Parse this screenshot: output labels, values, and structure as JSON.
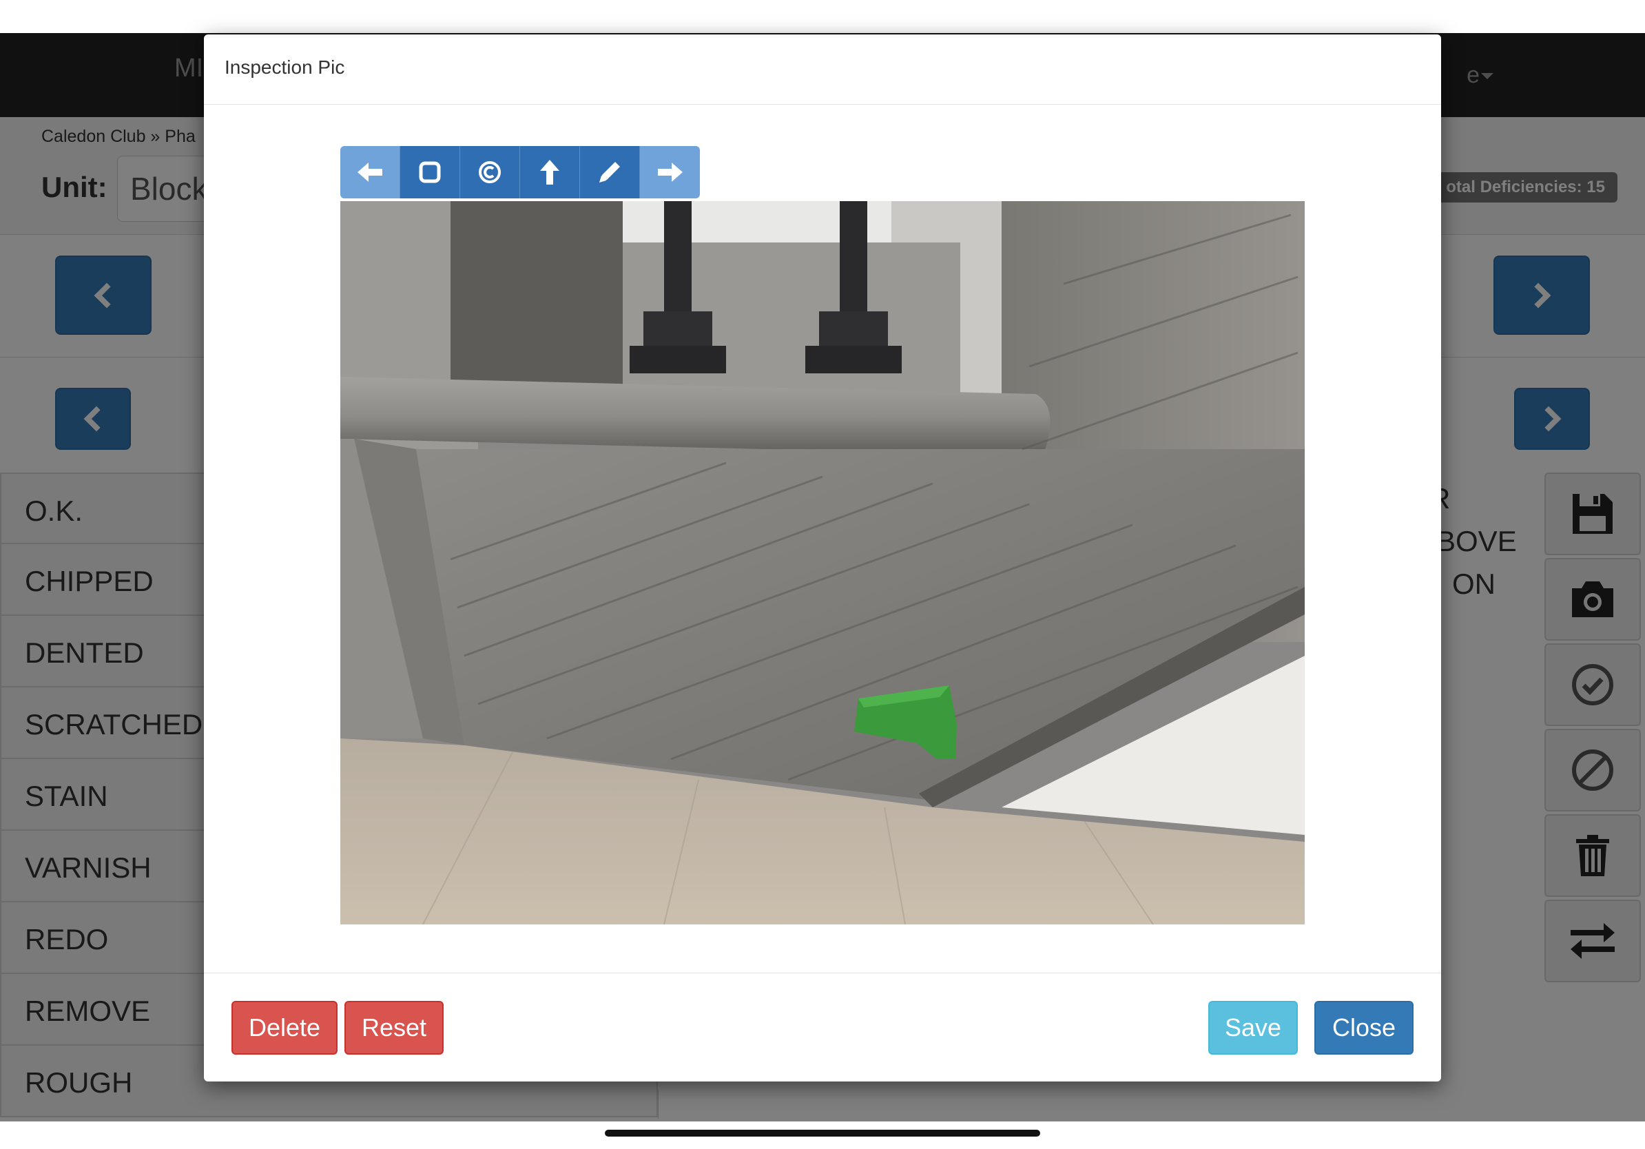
{
  "app": {
    "brand": "MI",
    "user": "e",
    "breadcrumb": "Caledon Club » Pha",
    "unit_label": "Unit:",
    "unit_value": "Block",
    "total_deficiencies": "otal Deficiencies: 15"
  },
  "condition_list": [
    "O.K.",
    "CHIPPED",
    "DENTED",
    "SCRATCHED",
    "STAIN",
    "VARNISH",
    "REDO",
    "REMOVE",
    "ROUGH"
  ],
  "description_fragments": [
    "R",
    "BOVE",
    "ON"
  ],
  "sidebar_tools": [
    "save-icon",
    "camera-icon",
    "check-circle-icon",
    "ban-icon",
    "trash-icon",
    "exchange-icon"
  ],
  "modal": {
    "title": "Inspection Pic",
    "toolbar": [
      {
        "icon": "arrow-left-icon",
        "active": false
      },
      {
        "icon": "square-icon",
        "active": true
      },
      {
        "icon": "circle-icon",
        "active": true
      },
      {
        "icon": "arrow-up-icon",
        "active": true
      },
      {
        "icon": "pencil-icon",
        "active": true
      },
      {
        "icon": "arrow-right-icon",
        "active": false
      }
    ],
    "buttons": {
      "delete": "Delete",
      "reset": "Reset",
      "save": "Save",
      "close": "Close"
    }
  },
  "colors": {
    "primary": "#337ab7",
    "danger": "#d9534f",
    "info": "#5bc0de",
    "navbar": "#222222",
    "toolbar_light": "#6fa3d9",
    "toolbar_active": "#2f6eb2"
  }
}
